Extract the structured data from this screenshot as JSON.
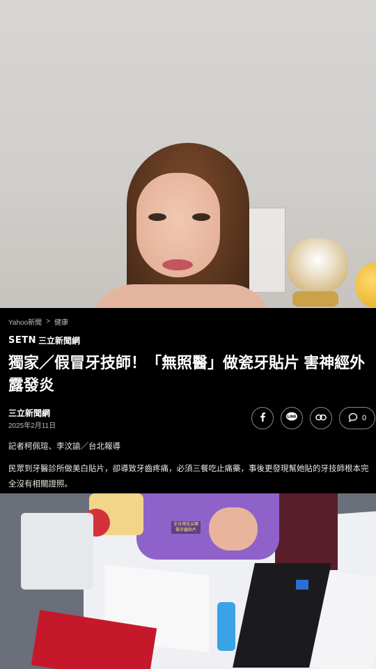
{
  "breadcrumb": {
    "source": "Yahoo新聞",
    "separator": ">",
    "section": "健康"
  },
  "brand": {
    "logo_mark": "SETN",
    "logo_name": "三立新聞網"
  },
  "article": {
    "headline": "獨家／假冒牙技師！「無照醫」做瓷牙貼片 害神經外露發炎",
    "publisher": "三立新聞網",
    "date": "2025年2月11日",
    "reporter": "記者柯佩瑄、李汶諭／台北報導",
    "body": "民眾到牙醫診所做美白貼片，卻導致牙齒疼痛，必須三餐吃止痛藥，事後更發現幫她貼的牙技師根本完全沒有相關證照。"
  },
  "share": {
    "facebook_icon": "facebook-icon",
    "line_icon": "line-icon",
    "link_icon": "link-icon",
    "comment_icon": "comment-icon",
    "comment_count": "0"
  },
  "video_caption": {
    "line1": "全台灣花ㄓ哪",
    "line2": "做牙齒貼片"
  },
  "colors": {
    "background": "#000000",
    "text": "#ffffff",
    "muted": "#bdbdbd"
  }
}
